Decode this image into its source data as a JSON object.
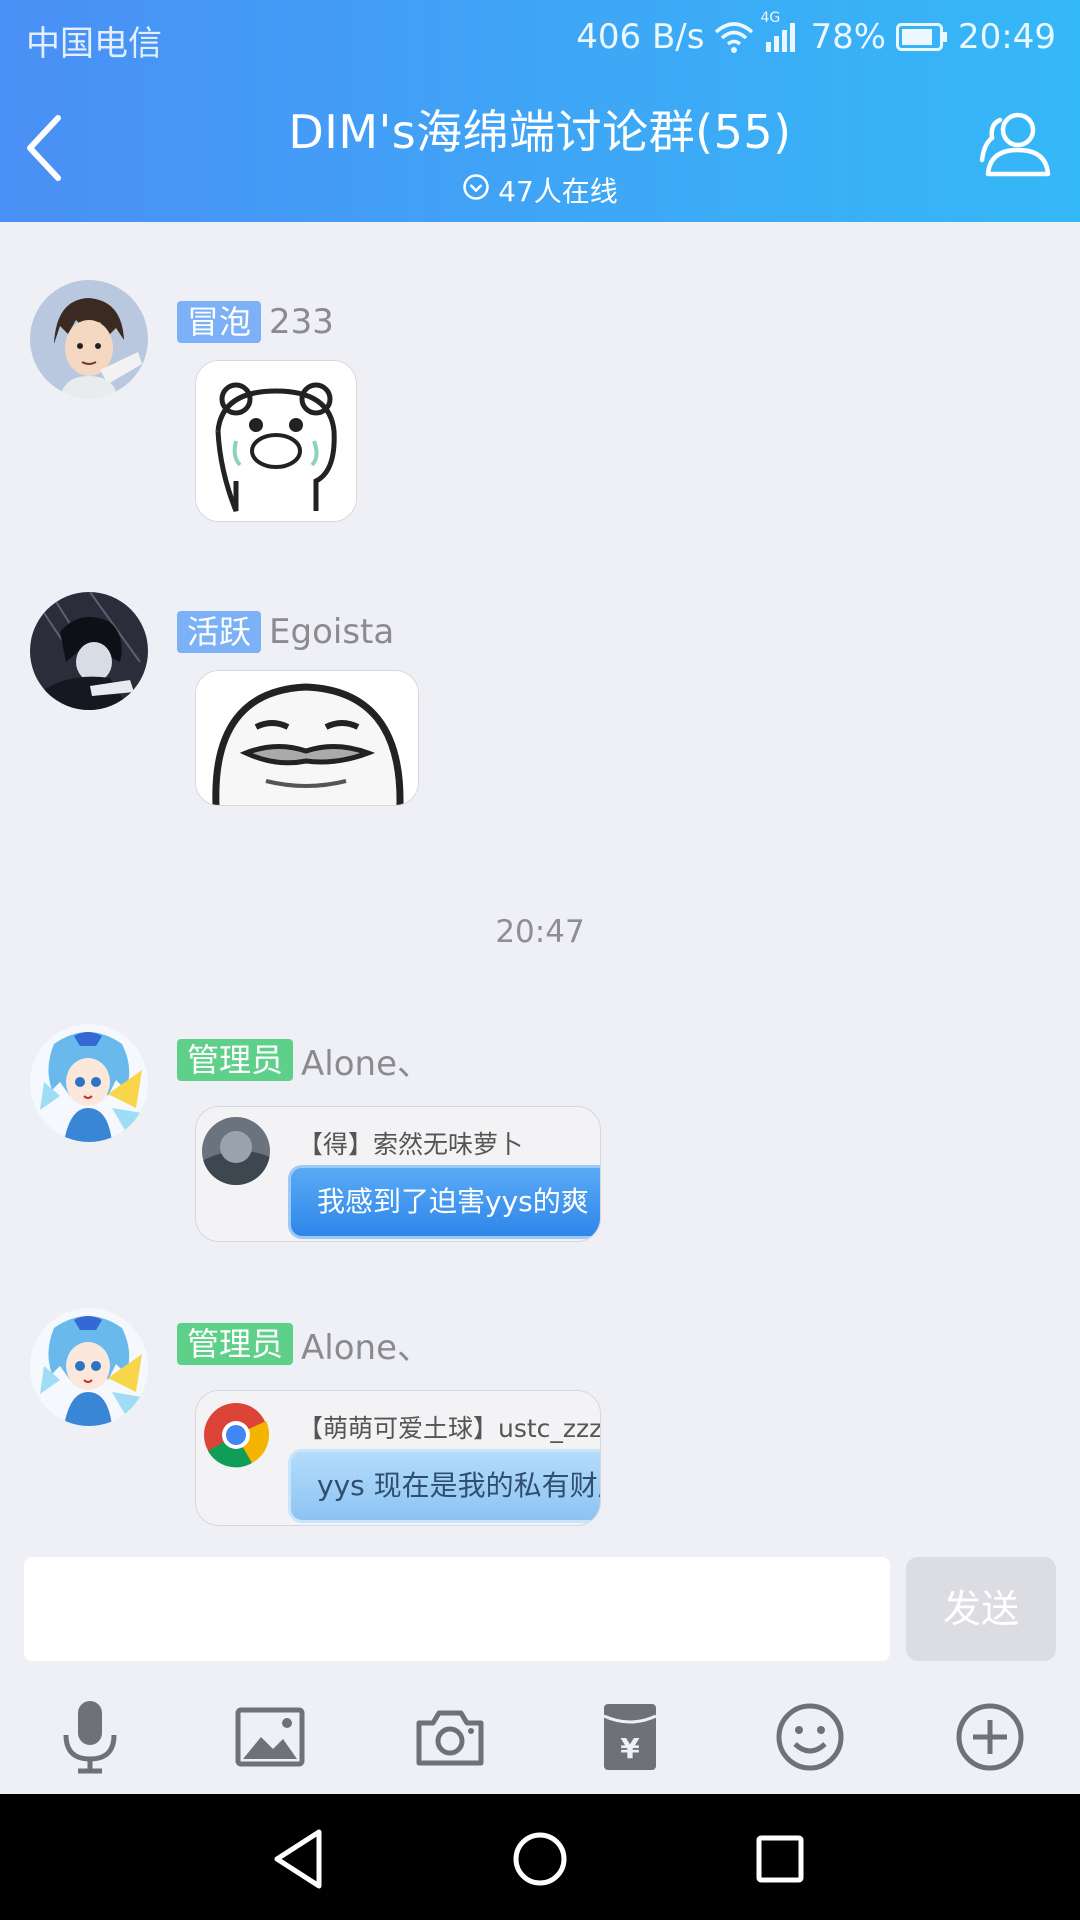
{
  "status_bar": {
    "carrier": "中国电信",
    "net_speed": "406 B/s",
    "network_type": "4G",
    "battery": "78%",
    "time": "20:49"
  },
  "header": {
    "title": "DIM's海绵端讨论群(55)",
    "online": "47人在线",
    "icons": {
      "back": "back-arrow-icon",
      "members": "group-members-icon"
    }
  },
  "messages": [
    {
      "badge": "冒泡",
      "badge_color": "#7cb1f7",
      "name": "233",
      "content_type": "sticker"
    },
    {
      "badge": "活跃",
      "badge_color": "#7cb1f7",
      "name": "Egoista",
      "content_type": "sticker"
    },
    {
      "badge": "管理员",
      "badge_color": "#5fd08a",
      "name": "Alone、",
      "content_type": "image",
      "quote_header": "【得】索然无味萝卜",
      "quote_text": "我感到了迫害yys的爽"
    },
    {
      "badge": "管理员",
      "badge_color": "#5fd08a",
      "name": "Alone、",
      "content_type": "image",
      "quote_header": "【萌萌可爱土球】ustc_zzzz",
      "quote_text": "yys 现在是我的私有财产"
    }
  ],
  "timestamp": "20:47",
  "input": {
    "placeholder": "",
    "send_label": "发送"
  },
  "toolbar": [
    "microphone-icon",
    "image-icon",
    "camera-icon",
    "red-packet-icon",
    "emoji-icon",
    "plus-icon"
  ],
  "colors": {
    "header_start": "#4a8ff5",
    "header_end": "#35b8f7",
    "background": "#eef0f6"
  }
}
